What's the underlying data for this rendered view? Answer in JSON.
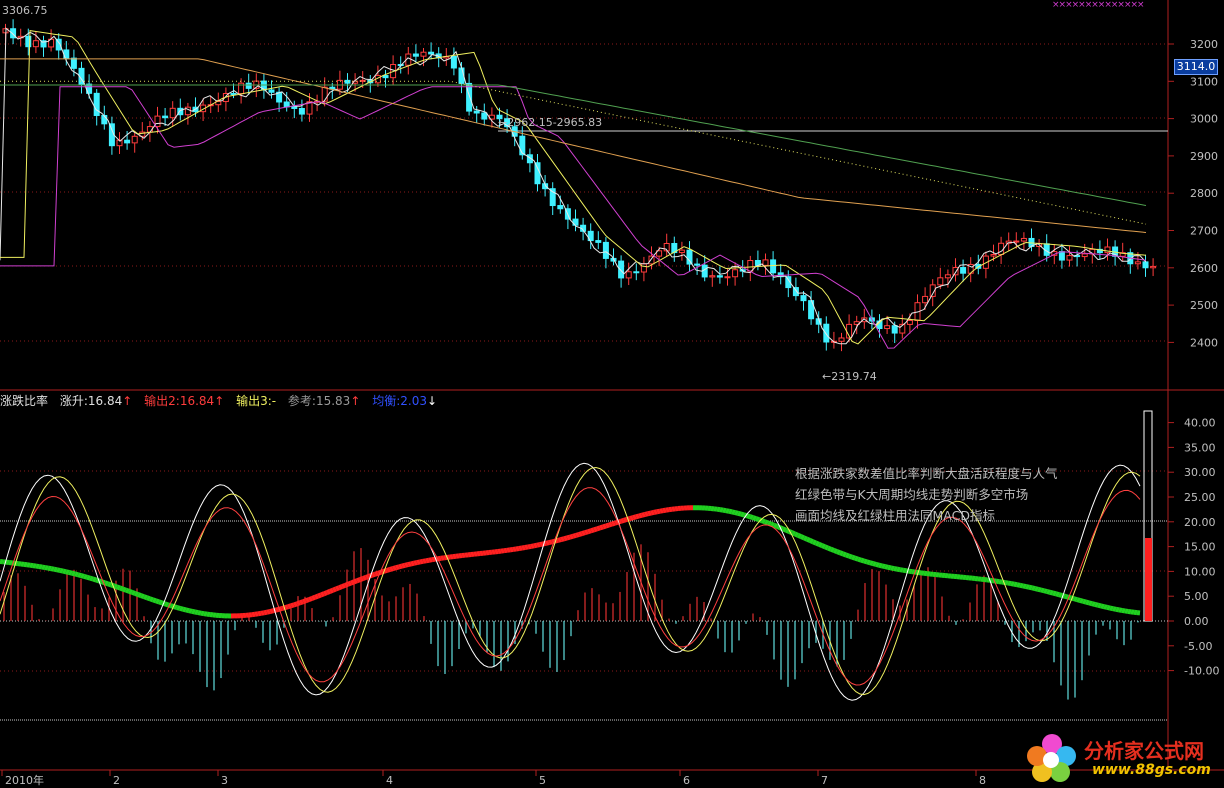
{
  "top_label": "3306.75",
  "purple_marks": "××××××××××××××",
  "price_tag": "3114.0",
  "price_axis": [
    "3200",
    "3100",
    "3000",
    "2900",
    "2800",
    "2700",
    "2600",
    "2500",
    "2400"
  ],
  "high_annotation": "2962.15-2965.83",
  "low_annotation": "2319.74",
  "indicator_header": {
    "name": "涨跌比率",
    "rise": "涨升:16.84",
    "out1": "输出2:16.84",
    "out2": "输出3:-",
    "ref": "参考:15.83",
    "equilibrium": "均衡:2.03"
  },
  "indicator_axis": [
    "40.00",
    "35.00",
    "30.00",
    "25.00",
    "20.00",
    "15.00",
    "10.00",
    "5.00",
    "0.00",
    "-5.00",
    "-10.00"
  ],
  "note_lines": [
    "根据涨跌家数差值比率判断大盘活跃程度与人气",
    "红绿色带与K大周期均线走势判断多空市场",
    "画面均线及红绿柱用法同MACD指标"
  ],
  "time_axis": [
    "2010年",
    "2",
    "3",
    "4",
    "5",
    "6",
    "7",
    "8"
  ],
  "logo": {
    "name": "分析家公式网",
    "url": "www.88gs.com"
  },
  "colors": {
    "up": "#ff3c3c",
    "down": "#3ff0ff",
    "grid": "#8b1a1a",
    "ma_white": "#e8e8e8",
    "ma_yellow": "#f0f060",
    "ma_purple": "#d040d0",
    "ma_orange": "#e0a050",
    "ma_green": "#50a050",
    "band_red": "#ff2020",
    "band_green": "#20d020"
  }
}
